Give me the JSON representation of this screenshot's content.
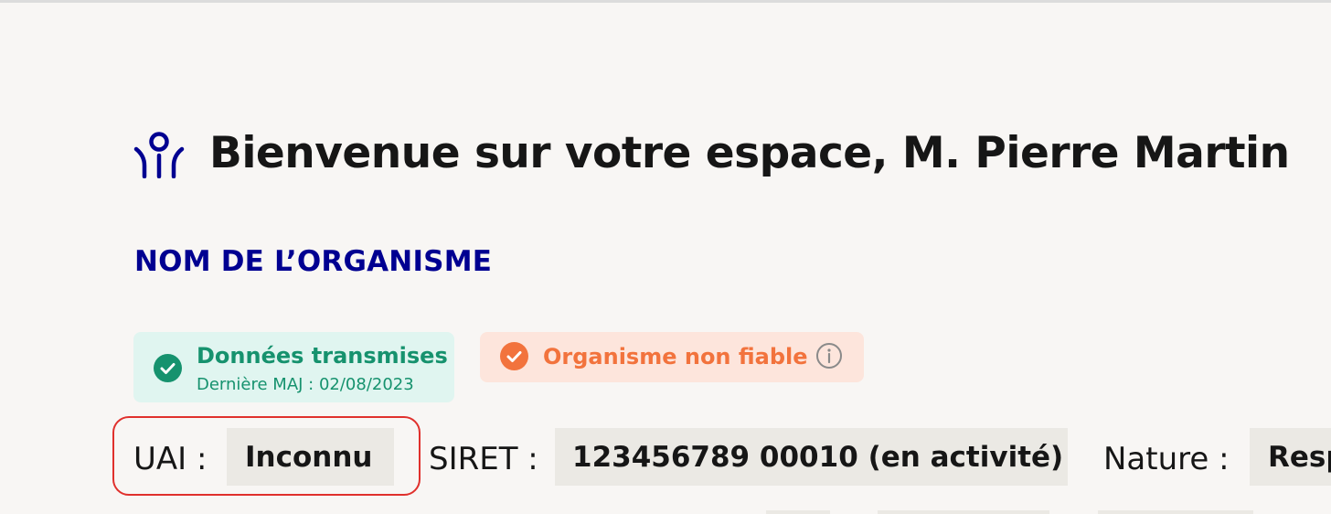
{
  "header": {
    "welcome_title": "Bienvenue sur votre espace, M. Pierre Martin",
    "org_name": "NOM DE L’ORGANISME"
  },
  "badges": {
    "transmitted": {
      "title": "Données transmises",
      "subtitle": "Dernière MAJ : 02/08/2023",
      "icon": "check-circle-icon",
      "color": "#16926e",
      "background": "#e0f5f0"
    },
    "unreliable": {
      "title": "Organisme non fiable",
      "icon": "check-circle-icon",
      "info_icon": "info-icon",
      "color": "#f2733d",
      "background": "#fde5dc"
    }
  },
  "fields": {
    "uai": {
      "label": "UAI :",
      "value": "Inconnu"
    },
    "siret": {
      "label": "SIRET :",
      "value": "123456789 00010 (en activité)"
    },
    "nature": {
      "label": "Nature :",
      "value": "Resp"
    }
  },
  "colors": {
    "brand_blue": "#000091",
    "highlight_red": "#e0302c"
  }
}
